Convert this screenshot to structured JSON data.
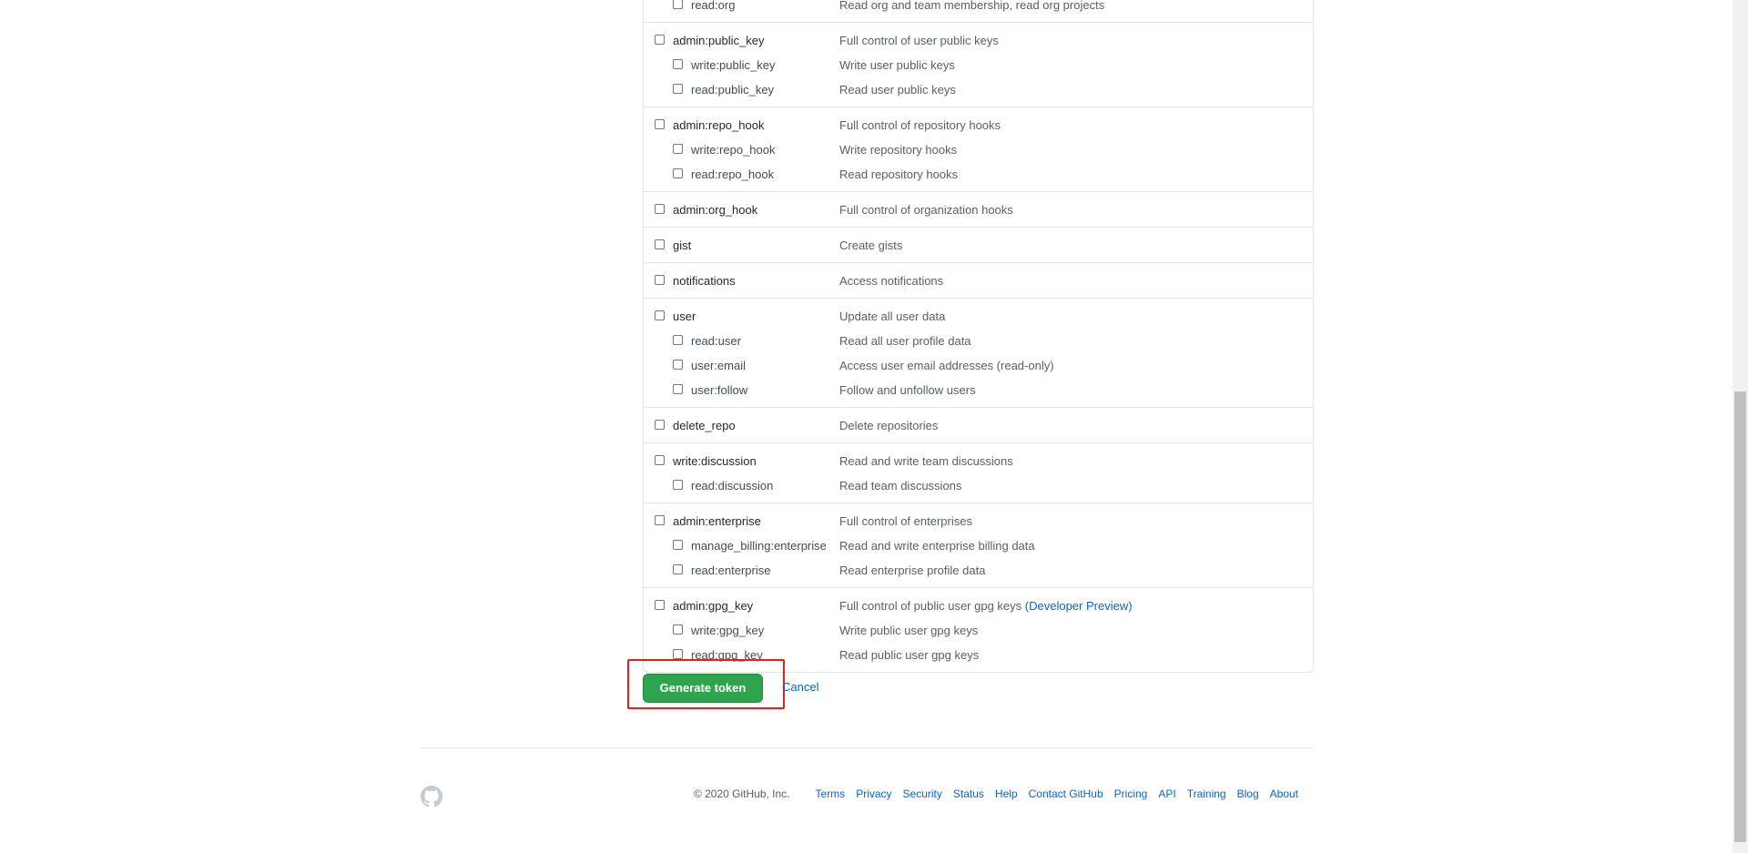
{
  "scopes": [
    {
      "name": "",
      "desc": "",
      "children": [
        {
          "name": "read:org",
          "desc": "Read org and team membership, read org projects"
        }
      ]
    },
    {
      "name": "admin:public_key",
      "desc": "Full control of user public keys",
      "children": [
        {
          "name": "write:public_key",
          "desc": "Write user public keys"
        },
        {
          "name": "read:public_key",
          "desc": "Read user public keys"
        }
      ]
    },
    {
      "name": "admin:repo_hook",
      "desc": "Full control of repository hooks",
      "children": [
        {
          "name": "write:repo_hook",
          "desc": "Write repository hooks"
        },
        {
          "name": "read:repo_hook",
          "desc": "Read repository hooks"
        }
      ]
    },
    {
      "name": "admin:org_hook",
      "desc": "Full control of organization hooks",
      "children": []
    },
    {
      "name": "gist",
      "desc": "Create gists",
      "children": []
    },
    {
      "name": "notifications",
      "desc": "Access notifications",
      "children": []
    },
    {
      "name": "user",
      "desc": "Update all user data",
      "children": [
        {
          "name": "read:user",
          "desc": "Read all user profile data"
        },
        {
          "name": "user:email",
          "desc": "Access user email addresses (read-only)"
        },
        {
          "name": "user:follow",
          "desc": "Follow and unfollow users"
        }
      ]
    },
    {
      "name": "delete_repo",
      "desc": "Delete repositories",
      "children": []
    },
    {
      "name": "write:discussion",
      "desc": "Read and write team discussions",
      "children": [
        {
          "name": "read:discussion",
          "desc": "Read team discussions"
        }
      ]
    },
    {
      "name": "admin:enterprise",
      "desc": "Full control of enterprises",
      "children": [
        {
          "name": "manage_billing:enterprise",
          "desc": "Read and write enterprise billing data"
        },
        {
          "name": "read:enterprise",
          "desc": "Read enterprise profile data"
        }
      ]
    },
    {
      "name": "admin:gpg_key",
      "desc": "Full control of public user gpg keys",
      "desc_link": "(Developer Preview)",
      "children": [
        {
          "name": "write:gpg_key",
          "desc": "Write public user gpg keys"
        },
        {
          "name": "read:gpg_key",
          "desc": "Read public user gpg keys"
        }
      ]
    }
  ],
  "actions": {
    "generate_label": "Generate token",
    "cancel_label": "Cancel"
  },
  "footer": {
    "copyright": "© 2020 GitHub, Inc.",
    "links": [
      "Terms",
      "Privacy",
      "Security",
      "Status",
      "Help",
      "Contact GitHub",
      "Pricing",
      "API",
      "Training",
      "Blog",
      "About"
    ]
  },
  "icons": {
    "footer_logo": "github-mark-icon"
  },
  "colors": {
    "primary_button": "#2ea44f",
    "link": "#0366d6",
    "highlight": "#ea1c1c"
  }
}
